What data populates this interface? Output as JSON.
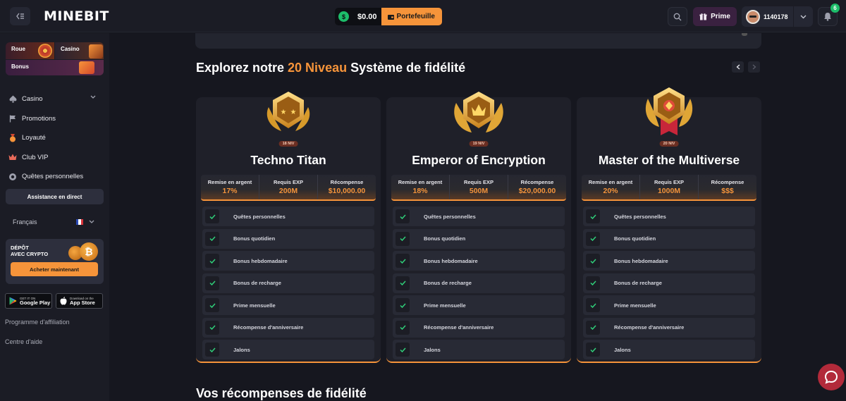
{
  "header": {
    "logo": "MINEBIT",
    "balance": "$0.00",
    "coin_symbol": "$",
    "wallet_label": "Portefeuille",
    "prime_label": "Prime",
    "user_id": "1140178",
    "notification_count": "6",
    "accent": "#f6943a",
    "success": "#1dbd6a"
  },
  "sidebar": {
    "promo": {
      "roue": "Roue",
      "casino": "Casino",
      "bonus": "Bonus"
    },
    "nav": [
      {
        "label": "Casino",
        "icon": "spade-icon"
      },
      {
        "label": "Promotions",
        "icon": "flag-icon"
      },
      {
        "label": "Loyauté",
        "icon": "medal-icon"
      },
      {
        "label": "Club VIP",
        "icon": "crown-icon"
      },
      {
        "label": "Quêtes personnelles",
        "icon": "quest-icon"
      }
    ],
    "assist_label": "Assistance en direct",
    "language": "Français",
    "crypto": {
      "title_line1": "DÉPÔT",
      "title_line2": "AVEC CRYPTO",
      "coin_symbol": "₿",
      "buy_label": "Acheter maintenant"
    },
    "google_play": {
      "small": "GET IT ON",
      "big": "Google Play"
    },
    "app_store": {
      "small": "Download on the",
      "big": "App Store"
    },
    "links": {
      "affiliate": "Programme d'affiliation",
      "help": "Centre d'aide"
    }
  },
  "main": {
    "title_prefix": "Explorez notre ",
    "title_highlight": "20 Niveau",
    "title_suffix": " Système de fidélité",
    "stat_labels": {
      "cashback": "Remise en argent",
      "exp": "Requis EXP",
      "reward": "Récompense"
    },
    "features": [
      "Quêtes personnelles",
      "Bonus quotidien",
      "Bonus hebdomadaire",
      "Bonus de recharge",
      "Prime mensuelle",
      "Récompense d'anniversaire",
      "Jalons"
    ],
    "levels": [
      {
        "level": "18 NIV",
        "name": "Techno Titan",
        "cashback": "17%",
        "exp": "200M",
        "reward": "$10,000.00"
      },
      {
        "level": "19 NIV",
        "name": "Emperor of Encryption",
        "cashback": "18%",
        "exp": "500M",
        "reward": "$20,000.00"
      },
      {
        "level": "20 NIV",
        "name": "Master of the Multiverse",
        "cashback": "20%",
        "exp": "1000M",
        "reward": "$$$"
      }
    ],
    "bottom_title": "Vos récompenses de fidélité"
  }
}
